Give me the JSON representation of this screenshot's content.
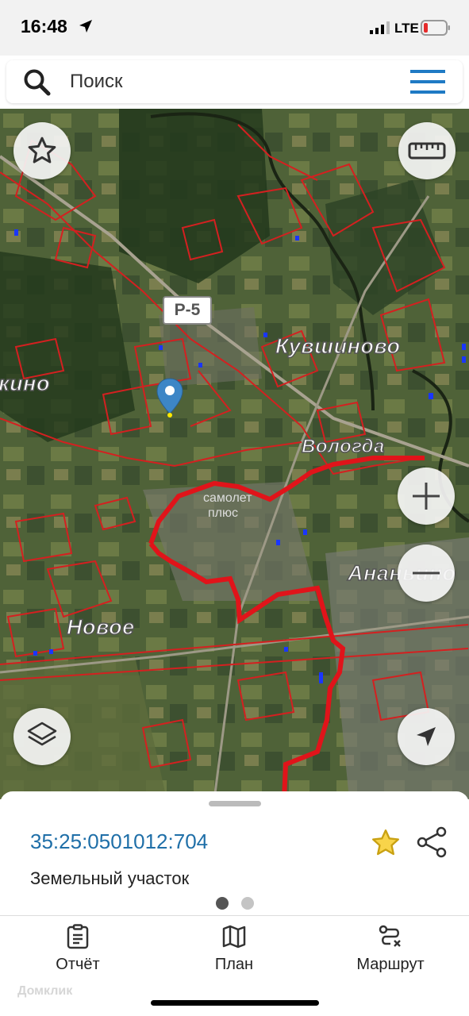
{
  "status": {
    "time": "16:48",
    "network": "LTE"
  },
  "search": {
    "placeholder": "Поиск"
  },
  "map": {
    "labels": {
      "kuvshinovo": "Кувшиново",
      "vologda": "Вологда",
      "novoe": "Новое",
      "anan": "Ананьино",
      "kino": "кино",
      "samolet": "самолет",
      "plus": "плюс"
    },
    "road_shield": "Р-5",
    "colors": {
      "boundary": "#d42020",
      "selected_boundary": "#e0141a",
      "pin": "#3d86c6"
    }
  },
  "details": {
    "cadastral_number": "35:25:0501012:704",
    "parcel_type": "Земельный участок"
  },
  "tabs": [
    {
      "label": "Отчёт",
      "icon": "report-icon"
    },
    {
      "label": "План",
      "icon": "map-plan-icon"
    },
    {
      "label": "Маршрут",
      "icon": "route-icon"
    }
  ],
  "watermark": "Домклик"
}
